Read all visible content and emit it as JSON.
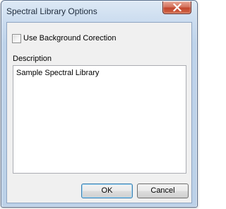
{
  "window": {
    "title": "Spectral Library Options"
  },
  "title_bar": {
    "close_icon": "close-icon"
  },
  "options": {
    "background_correction": {
      "label": "Use Background Corection",
      "checked": false
    },
    "description": {
      "label": "Description",
      "value": "Sample Spectral Library"
    }
  },
  "buttons": {
    "ok_label": "OK",
    "cancel_label": "Cancel"
  }
}
